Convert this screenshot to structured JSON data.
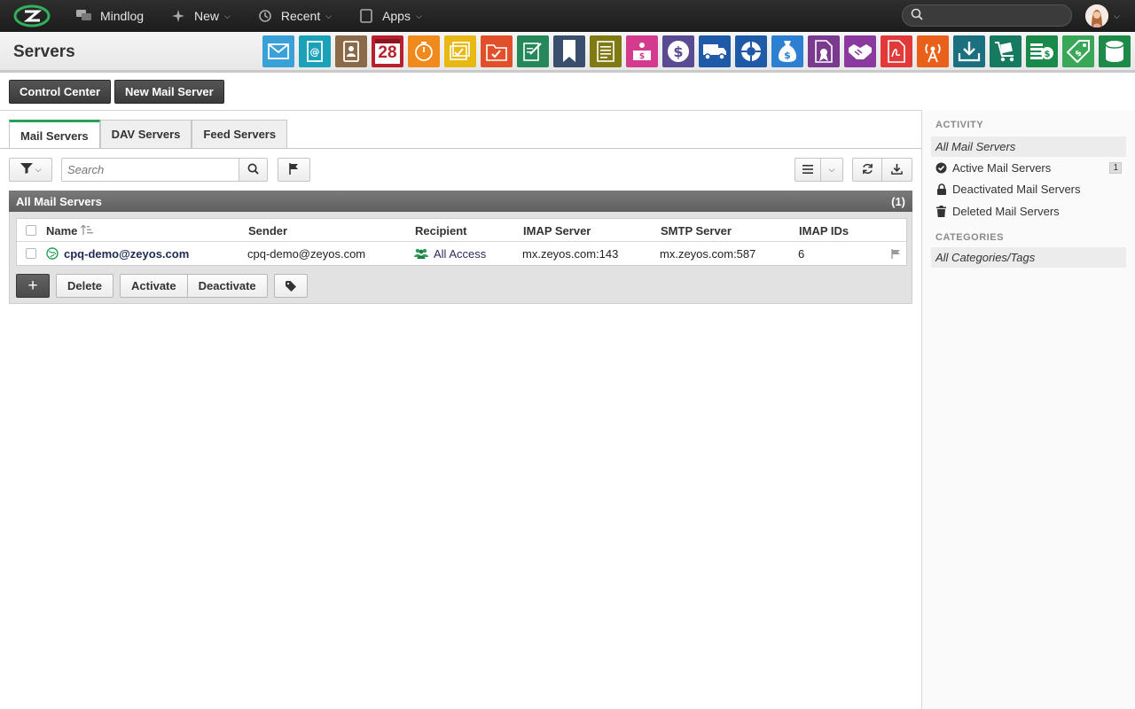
{
  "topbar": {
    "nav": [
      {
        "label": "Mindlog",
        "icon": "chat-icon"
      },
      {
        "label": "New",
        "icon": "sparkle-icon"
      },
      {
        "label": "Recent",
        "icon": "history-icon"
      },
      {
        "label": "Apps",
        "icon": "tablet-icon"
      }
    ],
    "search": {
      "placeholder": "",
      "value": ""
    }
  },
  "header": {
    "title": "Servers",
    "apps": [
      {
        "icon": "mail-icon",
        "color": "#3aa0d8"
      },
      {
        "icon": "address-book-icon",
        "color": "#1aa3b8"
      },
      {
        "icon": "contacts-icon",
        "color": "#8a6a48"
      },
      {
        "icon": "calendar-icon",
        "color": "#b8202d",
        "text": "28"
      },
      {
        "icon": "timer-icon",
        "color": "#f08a1c"
      },
      {
        "icon": "tasks-icon",
        "color": "#e8b814"
      },
      {
        "icon": "projects-icon",
        "color": "#e0502a"
      },
      {
        "icon": "notes-icon",
        "color": "#24885a"
      },
      {
        "icon": "bookmark-icon",
        "color": "#3a4f6e"
      },
      {
        "icon": "documents-icon",
        "color": "#7f7a14"
      },
      {
        "icon": "sales-desk-icon",
        "color": "#d43a8e"
      },
      {
        "icon": "dollar-icon",
        "color": "#5a4a92"
      },
      {
        "icon": "truck-icon",
        "color": "#1f5aa8"
      },
      {
        "icon": "support-icon",
        "color": "#1f5aa8"
      },
      {
        "icon": "money-bag-icon",
        "color": "#2d7fd1"
      },
      {
        "icon": "contract-icon",
        "color": "#7a3a8e"
      },
      {
        "icon": "handshake-icon",
        "color": "#8a3a9e"
      },
      {
        "icon": "pdf-icon",
        "color": "#e03a3a"
      },
      {
        "icon": "broadcast-icon",
        "color": "#e8601a"
      },
      {
        "icon": "download-icon",
        "color": "#1b7080"
      },
      {
        "icon": "cart-icon",
        "color": "#157a60"
      },
      {
        "icon": "cash-icon",
        "color": "#1a8a4a"
      },
      {
        "icon": "price-tag-icon",
        "color": "#38a858"
      },
      {
        "icon": "database-icon",
        "color": "#1e8a4a"
      }
    ]
  },
  "actions": {
    "control_center": "Control Center",
    "new_mail_server": "New Mail Server"
  },
  "tabs": [
    {
      "label": "Mail Servers",
      "active": true
    },
    {
      "label": "DAV Servers",
      "active": false
    },
    {
      "label": "Feed Servers",
      "active": false
    }
  ],
  "toolbar": {
    "search_placeholder": "Search"
  },
  "list": {
    "title": "All Mail Servers",
    "count": "(1)",
    "columns": [
      "Name",
      "Sender",
      "Recipient",
      "IMAP Server",
      "SMTP Server",
      "IMAP IDs"
    ],
    "rows": [
      {
        "name": "cpq-demo@zeyos.com",
        "sender": "cpq-demo@zeyos.com",
        "recipient": "All Access",
        "imap": "mx.zeyos.com:143",
        "smtp": "mx.zeyos.com:587",
        "imap_ids": "6"
      }
    ],
    "row_actions": {
      "add": "+",
      "delete": "Delete",
      "activate": "Activate",
      "deactivate": "Deactivate"
    }
  },
  "sidebar": {
    "activity_title": "ACTIVITY",
    "activity": [
      {
        "label": "All Mail Servers",
        "icon": "",
        "badge": ""
      },
      {
        "label": "Active Mail Servers",
        "icon": "check-circle-icon",
        "badge": "1"
      },
      {
        "label": "Deactivated Mail Servers",
        "icon": "lock-icon",
        "badge": ""
      },
      {
        "label": "Deleted Mail Servers",
        "icon": "trash-icon",
        "badge": ""
      }
    ],
    "categories_title": "CATEGORIES",
    "categories": [
      {
        "label": "All Categories/Tags"
      }
    ]
  }
}
